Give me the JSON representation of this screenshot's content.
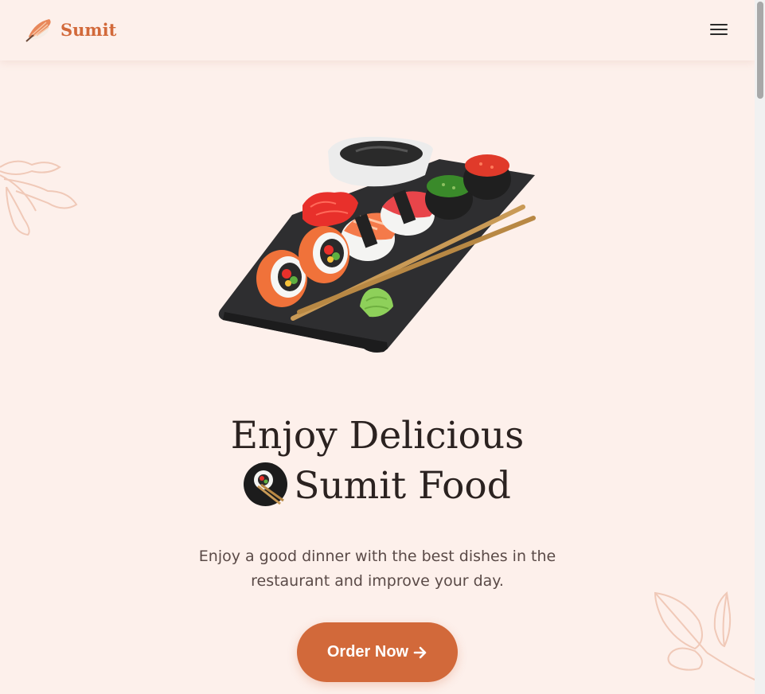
{
  "header": {
    "brand": "Sumit",
    "menu_icon": "hamburger-menu-icon"
  },
  "hero": {
    "title_line1": "Enjoy Delicious",
    "title_line2": "Sumit Food",
    "description": "Enjoy a good dinner with the best dishes in the restaurant and improve your day.",
    "cta_label": "Order Now",
    "cta_icon": "arrow-right-icon"
  },
  "colors": {
    "background": "#fdf0eb",
    "accent": "#d2693a",
    "text": "#2b2220"
  }
}
